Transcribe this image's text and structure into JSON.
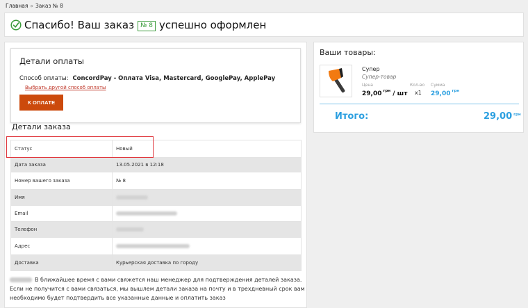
{
  "breadcrumb": {
    "home": "Главная",
    "separator": "»",
    "current": "Заказ № 8"
  },
  "header": {
    "title_pre": "Спасибо! Ваш заказ",
    "order_badge": "№ 8",
    "title_post": "успешно оформлен",
    "check_icon": "check-circle-icon",
    "accent": "#3c9c3c"
  },
  "payment": {
    "title": "Детали оплаты",
    "method_label": "Способ оплаты:",
    "method_value": "ConcordPay - Оплата Visa, Mastercard, GooglePay, ApplePay",
    "change_link": "Выбрать другой способ оплаты",
    "pay_button": "К ОПЛАТЕ",
    "button_color": "#cc4a0c"
  },
  "order_details": {
    "title": "Детали заказа",
    "rows": [
      {
        "key": "Статус",
        "value": "Новый"
      },
      {
        "key": "Дата заказа",
        "value": "13.05.2021 в 12:18"
      },
      {
        "key": "Номер вашего заказа",
        "value": "№ 8"
      },
      {
        "key": "Имя",
        "value": ""
      },
      {
        "key": "Email",
        "value": ""
      },
      {
        "key": "Телефон",
        "value": ""
      },
      {
        "key": "Адрес",
        "value": ""
      },
      {
        "key": "Доставка",
        "value": "Курьерская доставка по городу"
      }
    ],
    "highlight_color": "#e0383e"
  },
  "note": {
    "text": "В ближайшее время с вами свяжется наш менеджер для подтверждения деталей заказа. Если не получится с вами связаться, мы вышлем детали заказа на почту и в трехдневный срок вам необходимо будет подтвердить все указанные данные и оплатить заказ"
  },
  "cart": {
    "title": "Ваши товары:",
    "item": {
      "name": "Супер",
      "subtitle": "Супер-товар",
      "price_header": "Цена",
      "qty_header": "Кол-во",
      "sum_header": "Сумма",
      "price": "29,00",
      "currency": "грн",
      "price_unit": "/ шт",
      "qty": "x1",
      "sum": "29,00",
      "image_icon": "axe-icon"
    },
    "total_label": "Итого:",
    "total_value": "29,00",
    "accent": "#2b9fe0"
  }
}
